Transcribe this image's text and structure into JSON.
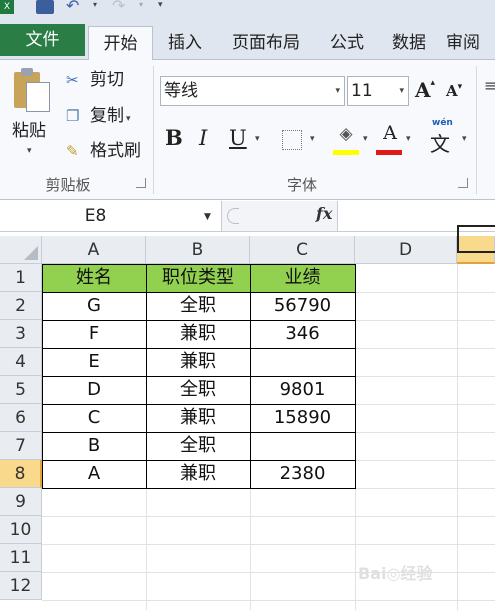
{
  "quick_access": {
    "app_icon": "excel-icon",
    "save_icon": "save-icon",
    "undo_icon": "undo-icon",
    "redo_icon": "redo-icon"
  },
  "tabs": [
    {
      "label": "文件"
    },
    {
      "label": "开始"
    },
    {
      "label": "插入"
    },
    {
      "label": "页面布局"
    },
    {
      "label": "公式"
    },
    {
      "label": "数据"
    },
    {
      "label": "审阅"
    }
  ],
  "clipboard": {
    "paste_label": "粘贴",
    "cut_label": "剪切",
    "copy_label": "复制",
    "format_painter_label": "格式刷",
    "group_label": "剪贴板"
  },
  "font": {
    "font_name": "等线",
    "font_size": "11",
    "bold": "B",
    "italic": "I",
    "underline": "U",
    "font_color_glyph": "A",
    "phonetic_ruby": "wén",
    "phonetic_char": "文",
    "group_label": "字体",
    "fill_color": "#ffff00",
    "font_color": "#e01919"
  },
  "formula_bar": {
    "name_box": "E8",
    "fx_label": "fx"
  },
  "grid": {
    "column_headers": [
      "A",
      "B",
      "C",
      "D"
    ],
    "row_headers": [
      "1",
      "2",
      "3",
      "4",
      "5",
      "6",
      "7",
      "8",
      "9",
      "10",
      "11",
      "12"
    ],
    "active_column": "E",
    "active_row": "8",
    "header_fill": "#92d050",
    "table": {
      "headers": [
        "姓名",
        "职位类型",
        "业绩"
      ],
      "rows": [
        [
          "G",
          "全职",
          "56790"
        ],
        [
          "F",
          "兼职",
          "346"
        ],
        [
          "E",
          "兼职",
          ""
        ],
        [
          "D",
          "全职",
          "9801"
        ],
        [
          "C",
          "兼职",
          "15890"
        ],
        [
          "B",
          "全职",
          ""
        ],
        [
          "A",
          "兼职",
          "2380"
        ]
      ]
    }
  }
}
